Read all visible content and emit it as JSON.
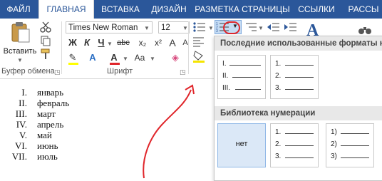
{
  "tabs": [
    {
      "label": "ФАЙЛ"
    },
    {
      "label": "ГЛАВНАЯ"
    },
    {
      "label": "ВСТАВКА"
    },
    {
      "label": "ДИЗАЙН"
    },
    {
      "label": "РАЗМЕТКА СТРАНИЦЫ"
    },
    {
      "label": "ССЫЛКИ"
    },
    {
      "label": "РАССЫ"
    }
  ],
  "clipboard": {
    "paste_label": "Вставить",
    "group_label": "Буфер обмена"
  },
  "font": {
    "name": "Times New Roman",
    "size": "12",
    "group_label": "Шрифт",
    "bold": "Ж",
    "italic": "К",
    "underline": "Ч",
    "strike": "abc",
    "sub": "x₂",
    "sup": "x²",
    "font_color": "A",
    "case": "Aa",
    "grow": "A",
    "shrink": "A",
    "highlight": "ab",
    "text_effect": "A"
  },
  "document_list": [
    {
      "num": "I.",
      "text": "январь"
    },
    {
      "num": "II.",
      "text": "февраль"
    },
    {
      "num": "III.",
      "text": "март"
    },
    {
      "num": "IV.",
      "text": "апрель"
    },
    {
      "num": "V.",
      "text": "май"
    },
    {
      "num": "VI.",
      "text": "июнь"
    },
    {
      "num": "VII.",
      "text": "июль"
    }
  ],
  "numbering_panel": {
    "recent_header": "Последние использованные форматы номе",
    "library_header": "Библиотека нумерации",
    "recent_formats": [
      [
        "I.",
        "II.",
        "III."
      ],
      [
        "1.",
        "2.",
        "3."
      ]
    ],
    "none_label": "нет",
    "library_formats": [
      [
        "1.",
        "2.",
        "3."
      ],
      [
        "1)",
        "2)",
        "3)"
      ]
    ]
  },
  "colors": {
    "ribbon_blue": "#2b579a",
    "annotation_red": "#e0262b",
    "selected_fill": "#dbe8f7"
  }
}
